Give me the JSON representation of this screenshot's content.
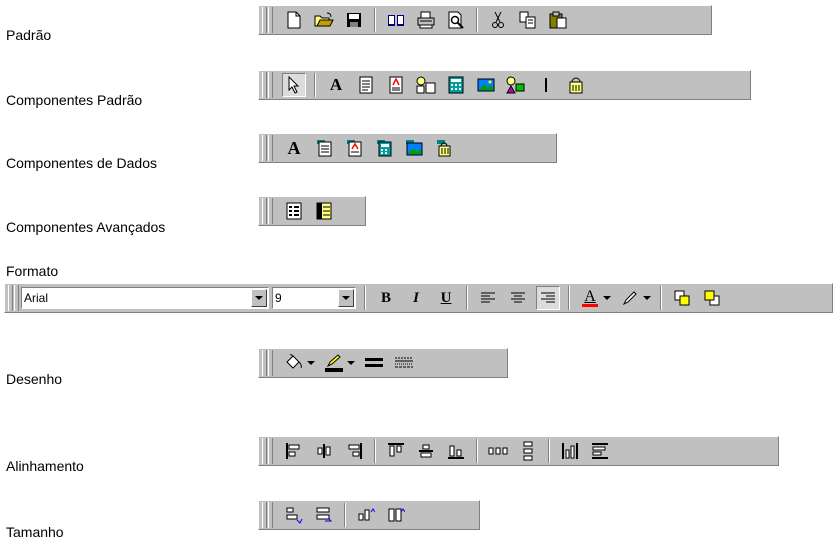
{
  "labels": {
    "padrao": "Padrão",
    "componentes_padrao": "Componentes Padrão",
    "componentes_dados": "Componentes de Dados",
    "componentes_avancados": "Componentes Avançados",
    "formato": "Formato",
    "desenho": "Desenho",
    "alinhamento": "Alinhamento",
    "tamanho": "Tamanho"
  },
  "format": {
    "font_name": "Arial",
    "font_size": "9",
    "bold_glyph": "B",
    "italic_glyph": "I",
    "underline_glyph": "U",
    "font_color_glyph": "A"
  },
  "componentes_padrao": {
    "label_glyph": "A"
  },
  "componentes_dados": {
    "dbtext_glyph": "A"
  },
  "colors": {
    "toolbar_bg": "#c0c0c0",
    "font_color_bar": "#ff0000",
    "line_color_bar": "#000000"
  }
}
